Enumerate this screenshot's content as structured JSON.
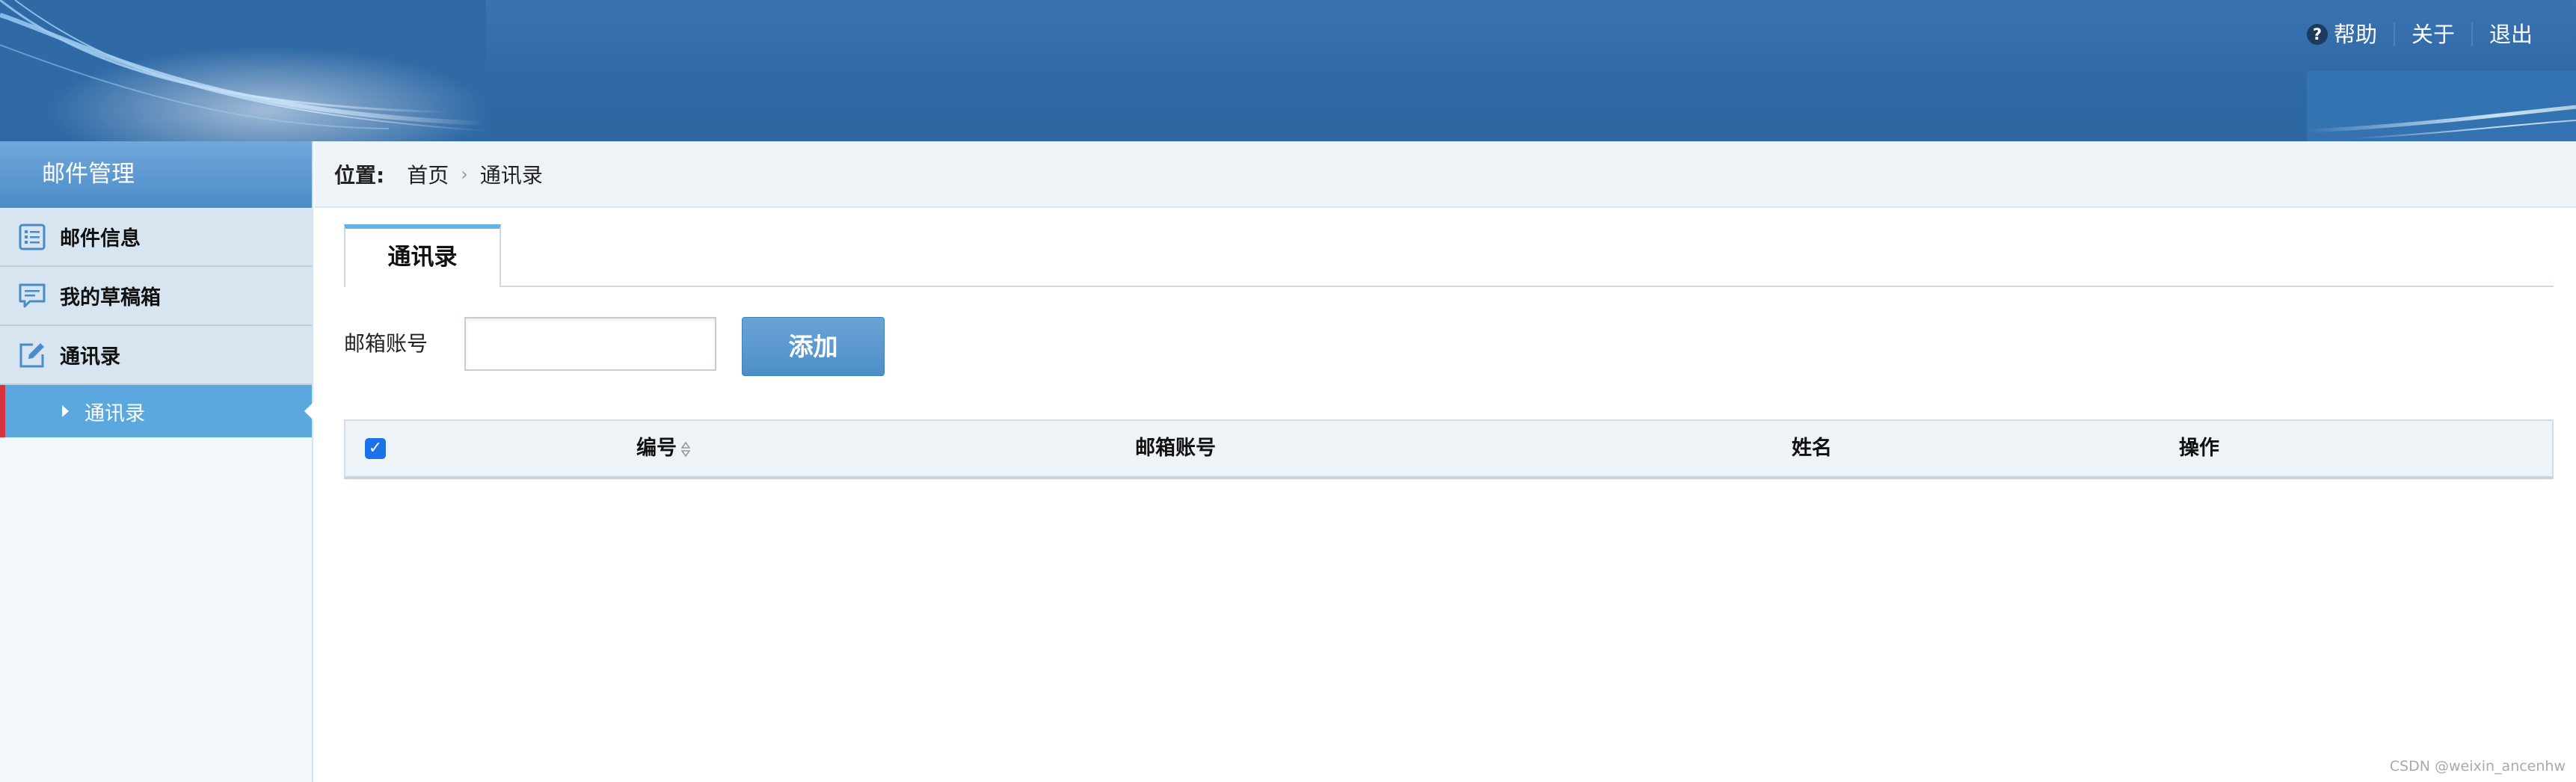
{
  "header": {
    "help_label": "帮助",
    "about_label": "关于",
    "logout_label": "退出",
    "help_icon": "question-icon"
  },
  "sidebar": {
    "title": "邮件管理",
    "items": [
      {
        "label": "邮件信息",
        "icon": "list-icon"
      },
      {
        "label": "我的草稿箱",
        "icon": "comment-icon"
      },
      {
        "label": "通讯录",
        "icon": "edit-icon"
      }
    ],
    "active_sub": {
      "label": "通讯录"
    }
  },
  "breadcrumb": {
    "position_label": "位置:",
    "home": "首页",
    "current": "通讯录"
  },
  "tabs": [
    {
      "label": "通讯录"
    }
  ],
  "search": {
    "label": "邮箱账号",
    "value": "",
    "add_label": "添加"
  },
  "table": {
    "columns": [
      "编号",
      "邮箱账号",
      "姓名",
      "操作"
    ],
    "select_all_checked": true,
    "rows": []
  },
  "watermark": "CSDN @weixin_ancenhw",
  "colors": {
    "banner": "#2f6aa6",
    "sidebar_header": "#4e8cc8",
    "active_item": "#5aa8dd",
    "active_marker": "#d9323a",
    "tab_accent": "#64b3e6"
  }
}
